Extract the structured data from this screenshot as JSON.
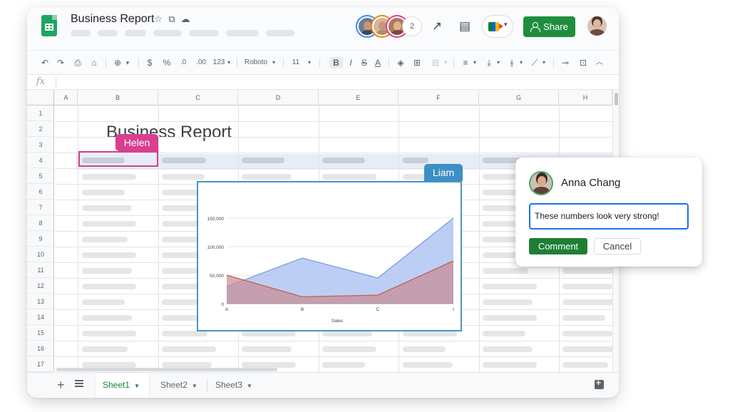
{
  "doc": {
    "title": "Business Report",
    "star_icon": "star-icon",
    "move_icon": "folder-move-icon",
    "cloud_icon": "cloud-saved-icon"
  },
  "header": {
    "share_label": "Share",
    "avatar_more": "2"
  },
  "toolbar": {
    "zoom_caret": "▾",
    "currency": "$",
    "percent": "%",
    "dec_less": ".0",
    "dec_more": ".00",
    "format_123": "123",
    "font": "Roboto",
    "font_size": "11",
    "bold": "B",
    "italic": "I",
    "strike": "S",
    "text_color": "A"
  },
  "formula": {
    "fx": "fx"
  },
  "columns": [
    "A",
    "B",
    "C",
    "D",
    "E",
    "F",
    "G",
    "H"
  ],
  "rows": [
    "1",
    "2",
    "3",
    "4",
    "5",
    "6",
    "7",
    "8",
    "9",
    "10",
    "11",
    "12",
    "13",
    "14",
    "15",
    "16",
    "17"
  ],
  "sheet": {
    "heading": "Business Report"
  },
  "collaborators": {
    "helen": "Helen",
    "liam": "Liam"
  },
  "chart_data": {
    "type": "area",
    "categories": [
      "A",
      "B",
      "C",
      "I"
    ],
    "series": [
      {
        "values": [
          30000,
          80000,
          45000,
          150000
        ],
        "color": "#a7bdf0"
      },
      {
        "values": [
          50000,
          12000,
          15000,
          75000
        ],
        "color": "#c98a93"
      }
    ],
    "xlabel": "Sales",
    "ylabel": "",
    "ylim": [
      0,
      150000
    ],
    "yticks": [
      "0",
      "50,000",
      "100,000",
      "150,000"
    ],
    "grid": true
  },
  "tabs": [
    {
      "label": "Sheet1",
      "active": true
    },
    {
      "label": "Sheet2",
      "active": false
    },
    {
      "label": "Sheet3",
      "active": false
    }
  ],
  "comment": {
    "author": "Anna Chang",
    "text": "These numbers look very strong!",
    "submit_label": "Comment",
    "cancel_label": "Cancel"
  },
  "colors": {
    "accent_green": "#1e8e3e",
    "helen": "#d93f8f",
    "liam": "#3d8fc4",
    "focus_blue": "#1a73e8"
  }
}
